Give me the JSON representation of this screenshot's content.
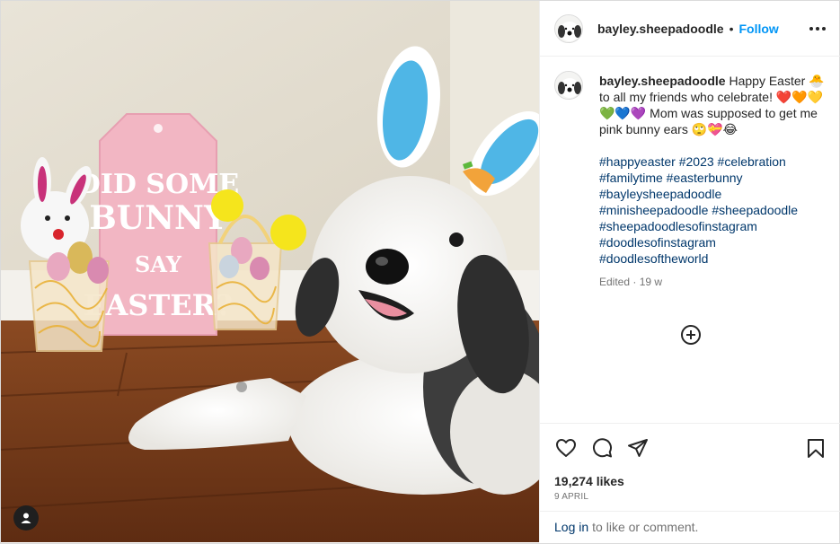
{
  "post": {
    "username": "bayley.sheepadoodle",
    "separator": "•",
    "follow_label": "Follow"
  },
  "photo": {
    "sign_text": [
      "DID SOME",
      "BUNNY",
      "SAY",
      "EASTER?"
    ]
  },
  "caption": {
    "username": "bayley.sheepadoodle",
    "text": "Happy Easter 🐣 to all my friends who celebrate! ❤️🧡💛💚💙💜 Mom was supposed to get me pink bunny ears 🙄💝😂",
    "hashtags": [
      "#happyeaster #2023 #celebration",
      "#familytime #easterbunny",
      "#bayleysheepadoodle",
      "#minisheepadoodle #sheepadoodle",
      "#sheepadoodlesofinstagram",
      "#doodlesofinstagram",
      "#doodlesoftheworld"
    ],
    "edited": "Edited · 19 w"
  },
  "actions": {
    "likes": "19,274 likes",
    "date": "9 APRIL"
  },
  "footer": {
    "login_link": "Log in",
    "login_text": "to like or comment."
  },
  "colors": {
    "follow": "#0095f6",
    "hashtag": "#00376b",
    "muted": "#737373"
  },
  "icons": [
    "more-options-icon",
    "load-more-comments-icon",
    "heart-icon",
    "comment-icon",
    "share-icon",
    "bookmark-icon",
    "user-tag-icon"
  ]
}
